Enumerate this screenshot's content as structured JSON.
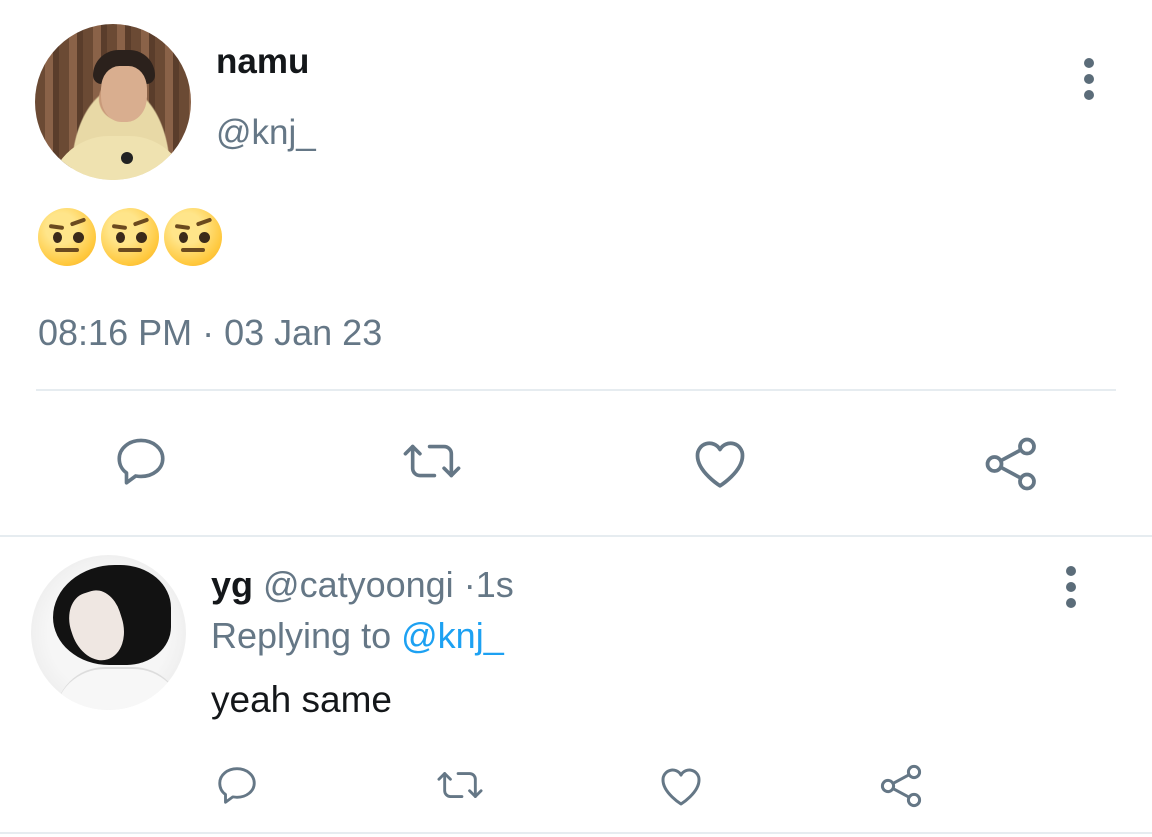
{
  "tweet": {
    "display_name": "namu",
    "handle": "@knj_",
    "emoji_count": 3,
    "timestamp": "08:16 PM · 03 Jan 23"
  },
  "reply": {
    "display_name": "yg",
    "handle": "@catyoongi",
    "time_sep": "·",
    "time": "1s",
    "replying_prefix": "Replying to",
    "replying_to": "@knj_",
    "text": "yeah same"
  },
  "icons": {
    "more": "more-vertical-icon",
    "reply": "reply-icon",
    "retweet": "retweet-icon",
    "like": "heart-icon",
    "share": "share-icon"
  },
  "colors": {
    "text": "#14171a",
    "secondary": "#657786",
    "link": "#1da1f2",
    "divider": "#e6ecf0"
  }
}
